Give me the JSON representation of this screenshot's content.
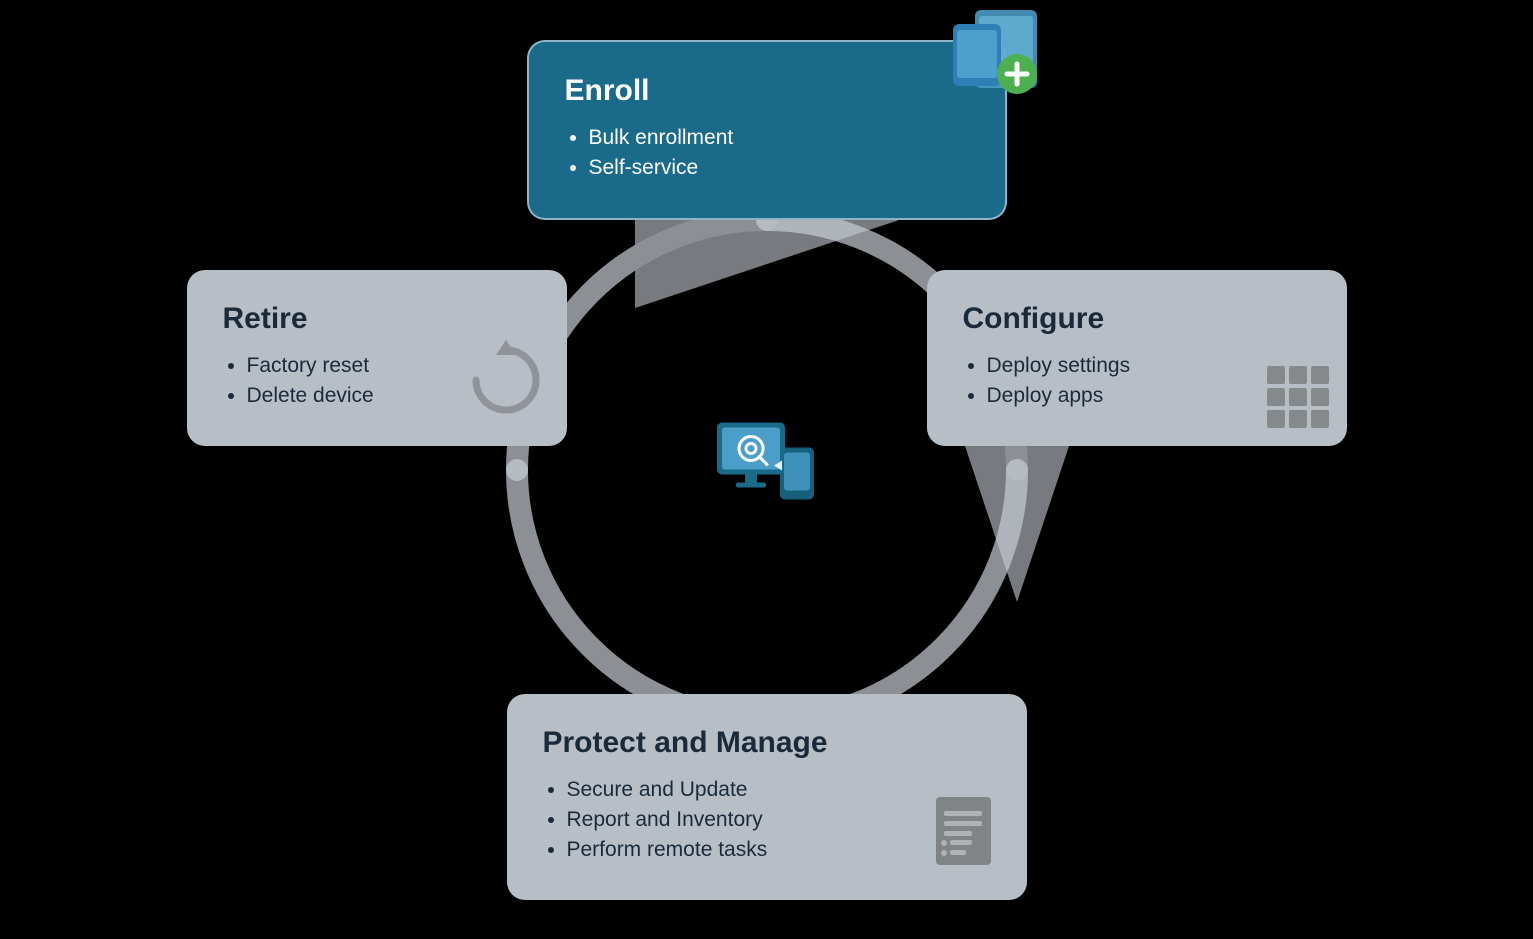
{
  "cards": {
    "enroll": {
      "title": "Enroll",
      "items": [
        "Bulk enrollment",
        "Self-service"
      ],
      "bg": "#1a6a8a"
    },
    "configure": {
      "title": "Configure",
      "items": [
        "Deploy settings",
        "Deploy apps"
      ],
      "bg": "#b8bec5"
    },
    "protect": {
      "title": "Protect and Manage",
      "items": [
        "Secure and Update",
        "Report and Inventory",
        "Perform remote tasks"
      ],
      "bg": "#b8bec5"
    },
    "retire": {
      "title": "Retire",
      "items": [
        "Factory reset",
        "Delete device"
      ],
      "bg": "#b8bec5"
    }
  },
  "background": "#000000"
}
